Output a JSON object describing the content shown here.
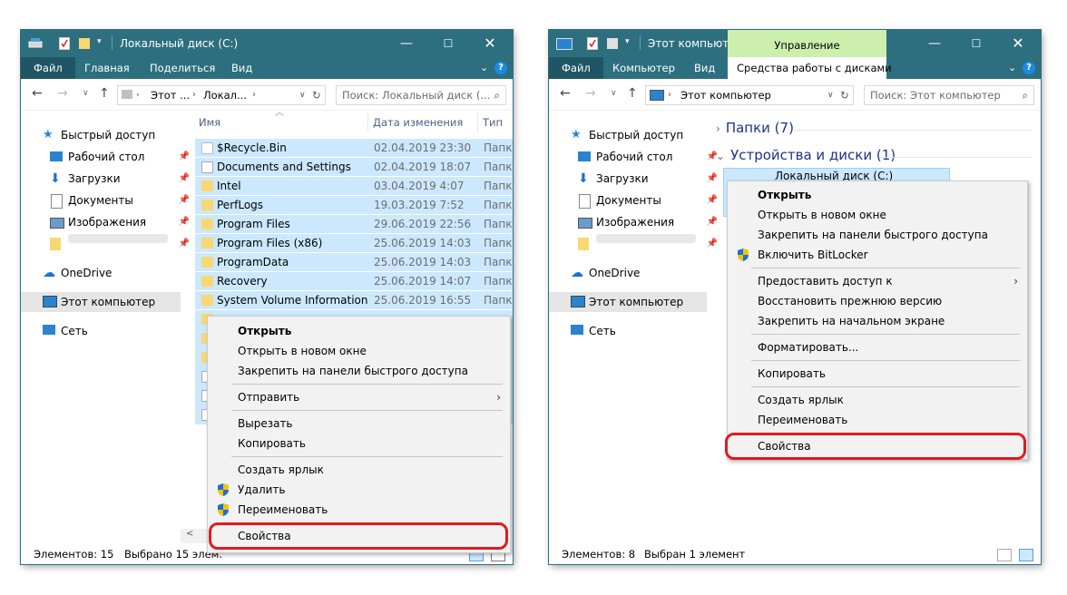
{
  "w1": {
    "title": "Локальный диск (C:)",
    "tabs": [
      "Файл",
      "Главная",
      "Поделиться",
      "Вид"
    ],
    "address": {
      "seg1": "Этот ...",
      "seg2": "Локал..."
    },
    "search_placeholder": "Поиск: Локальный диск (...",
    "columns": {
      "name": "Имя",
      "date": "Дата изменения",
      "type": "Тип"
    },
    "rows": [
      {
        "name": "$Recycle.Bin",
        "date": "02.04.2019 23:30",
        "type": "Папка"
      },
      {
        "name": "Documents and Settings",
        "date": "02.04.2019 18:07",
        "type": "Папка"
      },
      {
        "name": "Intel",
        "date": "03.04.2019 4:07",
        "type": "Папка"
      },
      {
        "name": "PerfLogs",
        "date": "19.03.2019 7:52",
        "type": "Папка"
      },
      {
        "name": "Program Files",
        "date": "29.06.2019 22:56",
        "type": "Папка"
      },
      {
        "name": "Program Files (x86)",
        "date": "25.06.2019 14:03",
        "type": "Папка"
      },
      {
        "name": "ProgramData",
        "date": "25.06.2019 14:03",
        "type": "Папка"
      },
      {
        "name": "Recovery",
        "date": "25.06.2019 14:07",
        "type": "Папка"
      },
      {
        "name": "System Volume Information",
        "date": "25.06.2019 16:55",
        "type": "Папка"
      }
    ],
    "status": {
      "count": "Элементов: 15",
      "selected": "Выбрано 15 элем."
    },
    "menu": {
      "open": "Открыть",
      "open_new": "Открыть в новом окне",
      "pin_quick": "Закрепить на панели быстрого доступа",
      "send_to": "Отправить",
      "cut": "Вырезать",
      "copy": "Копировать",
      "shortcut": "Создать ярлык",
      "delete": "Удалить",
      "rename": "Переименовать",
      "properties": "Свойства"
    }
  },
  "w2": {
    "title": "Этот компьют...",
    "context_group": "Управление",
    "tabs": [
      "Файл",
      "Компьютер",
      "Вид",
      "Средства работы с дисками"
    ],
    "address": "Этот компьютер",
    "search_placeholder": "Поиск: Этот компьютер",
    "sections": {
      "folders": "Папки (7)",
      "devices": "Устройства и диски (1)"
    },
    "drive_label": "Локальный диск (C:)",
    "status": {
      "count": "Элементов: 8",
      "selected": "Выбран 1 элемент"
    },
    "menu": {
      "open": "Открыть",
      "open_new": "Открыть в новом окне",
      "pin_quick": "Закрепить на панели быстрого доступа",
      "bitlocker": "Включить BitLocker",
      "share": "Предоставить доступ к",
      "restore": "Восстановить прежнюю версию",
      "pin_start": "Закрепить на начальном экране",
      "format": "Форматировать...",
      "copy": "Копировать",
      "shortcut": "Создать ярлык",
      "rename": "Переименовать",
      "properties": "Свойства"
    }
  },
  "nav": {
    "quick_access": "Быстрый доступ",
    "desktop": "Рабочий стол",
    "downloads": "Загрузки",
    "documents": "Документы",
    "pictures": "Изображения",
    "onedrive": "OneDrive",
    "this_pc": "Этот компьютер",
    "network": "Сеть"
  },
  "colors": {
    "title_bar": "#2d6f7e",
    "selection": "#cce8ff",
    "highlight": "#e2191f",
    "context_tab": "#ccefad"
  }
}
